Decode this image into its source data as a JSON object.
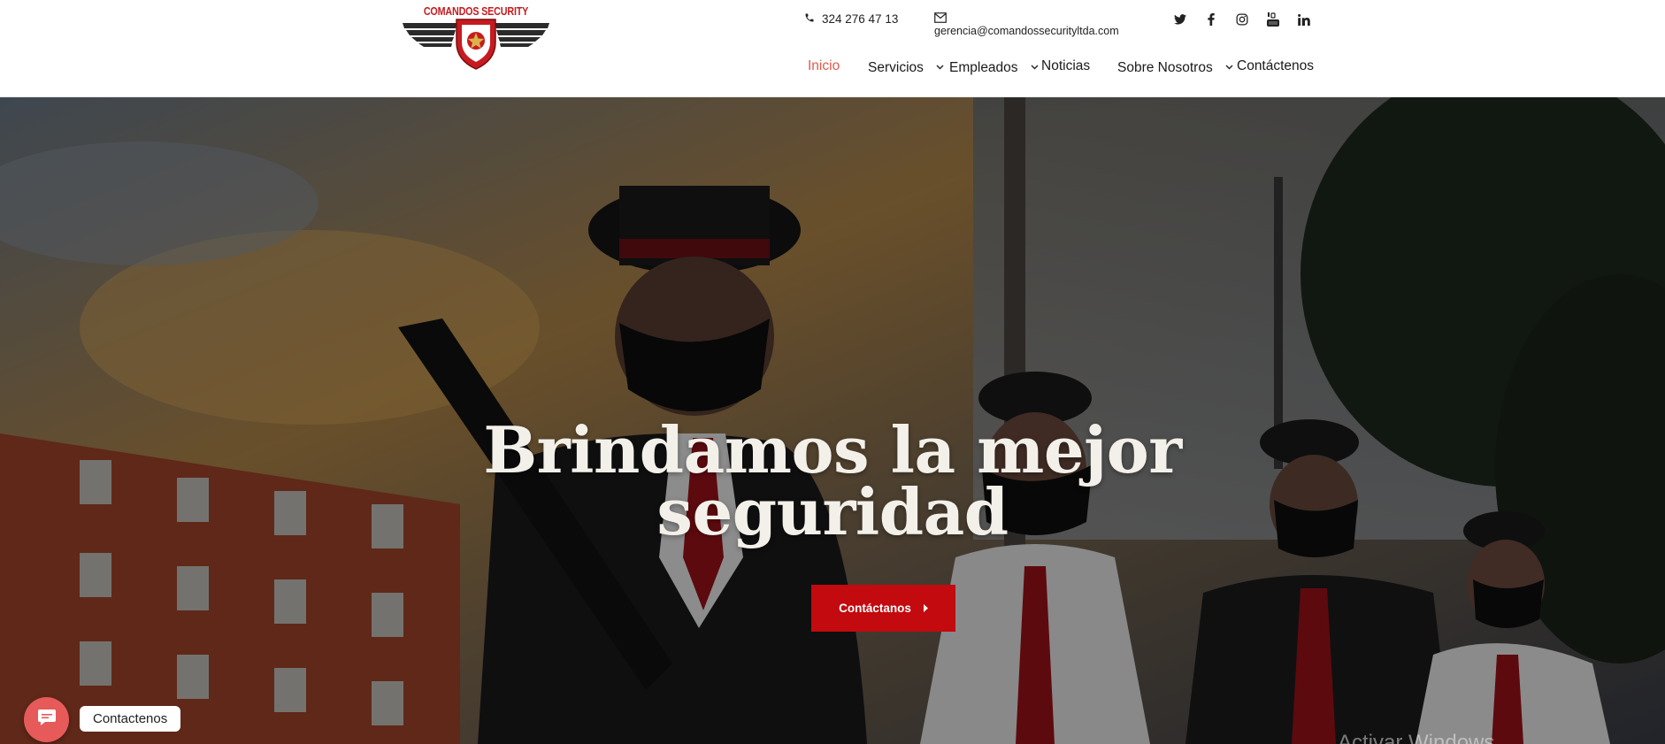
{
  "brand": {
    "name": "COMANDOS SECURITY LTDA."
  },
  "contact": {
    "phone": "324 276 47 13",
    "email": "gerencia@comandossecurityltda.com"
  },
  "social": [
    {
      "icon": "twitter-icon"
    },
    {
      "icon": "facebook-icon"
    },
    {
      "icon": "instagram-icon"
    },
    {
      "icon": "youtube-icon"
    },
    {
      "icon": "linkedin-icon"
    }
  ],
  "nav": {
    "items": [
      {
        "label": "Inicio",
        "active": true,
        "dropdown": false
      },
      {
        "label": "Servicios",
        "active": false,
        "dropdown": true
      },
      {
        "label": "Empleados",
        "active": false,
        "dropdown": true
      },
      {
        "label": "Noticias",
        "active": false,
        "dropdown": false
      },
      {
        "label": "Sobre Nosotros",
        "active": false,
        "dropdown": true
      },
      {
        "label": "Contáctenos",
        "active": false,
        "dropdown": false
      }
    ]
  },
  "hero": {
    "title_line1": "Brindamos la mejor",
    "title_line2": "seguridad",
    "cta_label": "Contáctanos"
  },
  "chat": {
    "label": "Contactenos"
  },
  "watermark": "Activar Windows",
  "colors": {
    "accent": "#c20a0f",
    "active_nav": "#e3584a",
    "chat": "#e65a5a"
  }
}
